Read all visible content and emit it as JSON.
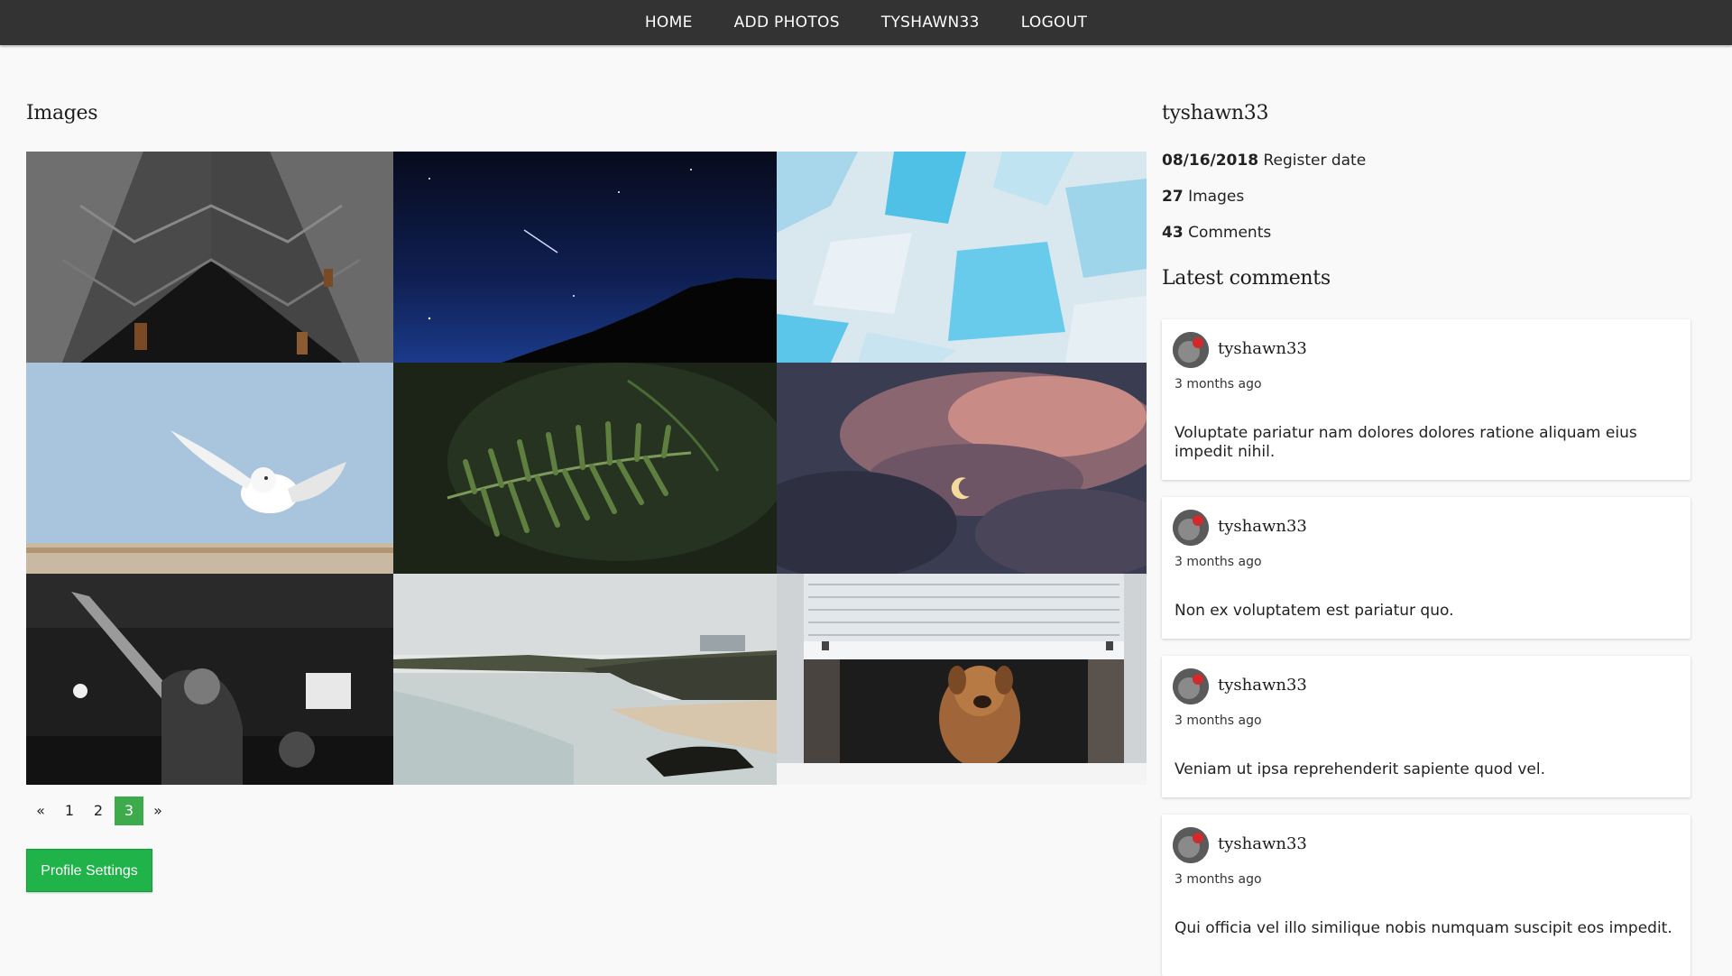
{
  "nav": {
    "items": [
      "HOME",
      "ADD PHOTOS",
      "TYSHAWN33",
      "LOGOUT"
    ]
  },
  "gallery": {
    "title": "Images",
    "photos": [
      {
        "subject": "architecture-building"
      },
      {
        "subject": "night-sky-shooting-star"
      },
      {
        "subject": "glacier-ice"
      },
      {
        "subject": "snowy-owl-flying"
      },
      {
        "subject": "fern-leaves"
      },
      {
        "subject": "moon-clouds"
      },
      {
        "subject": "concert-crowd"
      },
      {
        "subject": "beach-cliffs"
      },
      {
        "subject": "dog-in-window"
      }
    ]
  },
  "pagination": {
    "prev": "«",
    "pages": [
      "1",
      "2",
      "3"
    ],
    "current": "3",
    "next": "»"
  },
  "profile_settings_label": "Profile Settings",
  "profile": {
    "username": "tyshawn33",
    "register_date": "08/16/2018",
    "register_label": "Register date",
    "images_count": "27",
    "images_label": "Images",
    "comments_count": "43",
    "comments_label": "Comments"
  },
  "latest_comments": {
    "title": "Latest comments",
    "items": [
      {
        "user": "tyshawn33",
        "time": "3 months ago",
        "text": "Voluptate pariatur nam dolores dolores ratione aliquam eius impedit nihil."
      },
      {
        "user": "tyshawn33",
        "time": "3 months ago",
        "text": "Non ex voluptatem est pariatur quo."
      },
      {
        "user": "tyshawn33",
        "time": "3 months ago",
        "text": "Veniam ut ipsa reprehenderit sapiente quod vel."
      },
      {
        "user": "tyshawn33",
        "time": "3 months ago",
        "text": "Qui officia vel illo similique nobis numquam suscipit eos impedit."
      }
    ]
  },
  "colors": {
    "navbar": "#333333",
    "accent_green": "#1fb34a",
    "page_active": "#3dab4c",
    "background": "#f9f9f9"
  }
}
